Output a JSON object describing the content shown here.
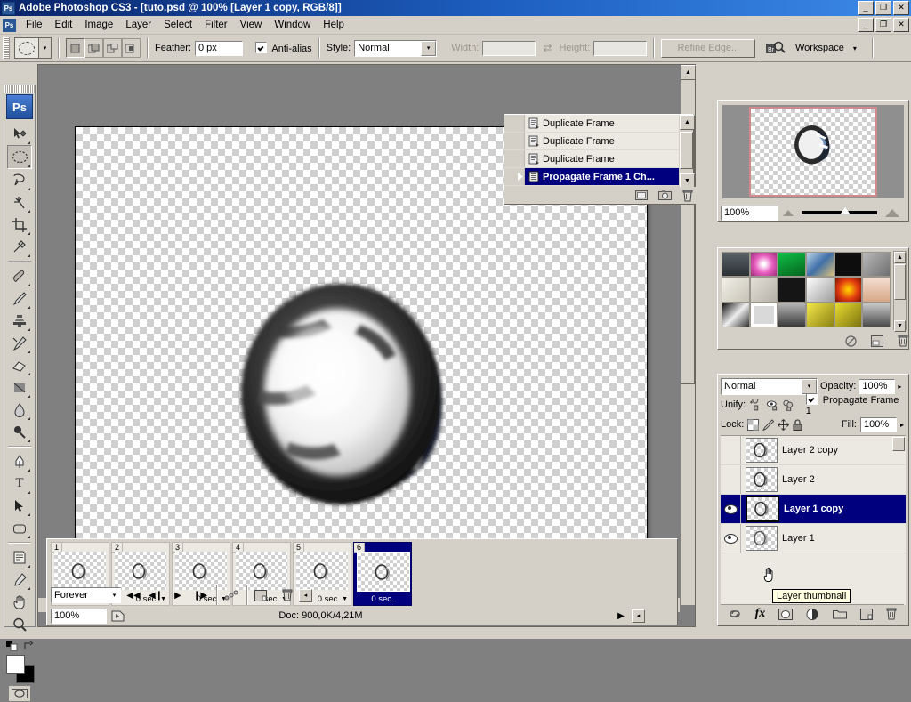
{
  "window": {
    "title": "Adobe Photoshop CS3 - [tuto.psd @ 100% [Layer 1 copy, RGB/8]]",
    "app_icon": "Ps",
    "minimize": "_",
    "restore": "❐",
    "close": "✕"
  },
  "menubar": {
    "app_icon": "Ps",
    "items": [
      {
        "label": "File"
      },
      {
        "label": "Edit"
      },
      {
        "label": "Image"
      },
      {
        "label": "Layer"
      },
      {
        "label": "Select"
      },
      {
        "label": "Filter"
      },
      {
        "label": "View"
      },
      {
        "label": "Window"
      },
      {
        "label": "Help"
      }
    ],
    "minimize": "_",
    "restore": "❐",
    "close": "✕"
  },
  "optionsbar": {
    "tool_icon": "elliptical-marquee",
    "tool_dropdown_arrow": "▾",
    "selection_modes": [
      "new-selection",
      "add-to-selection",
      "subtract-from-selection",
      "intersect-with-selection"
    ],
    "feather_label": "Feather:",
    "feather_value": "0 px",
    "antialias_label": "Anti-alias",
    "antialias_checked": true,
    "style_label": "Style:",
    "style_value": "Normal",
    "style_arrow": "▾",
    "width_label": "Width:",
    "width_value": "",
    "swap_icon": "⇄",
    "height_label": "Height:",
    "height_value": "",
    "refine_edge_label": "Refine Edge...",
    "refine_edge_enabled": false,
    "bridge_icon": "Br",
    "workspace_label": "Workspace",
    "workspace_arrow": "▾"
  },
  "toolbox": {
    "logo": "Ps",
    "tools": [
      {
        "name": "move-tool",
        "glyph": "↖",
        "selected": false,
        "has_flyout": false
      },
      {
        "name": "elliptical-marquee-tool",
        "glyph": "◯",
        "selected": true,
        "has_flyout": true
      },
      {
        "name": "lasso-tool",
        "glyph": "☂",
        "selected": false,
        "has_flyout": true
      },
      {
        "name": "magic-wand-tool",
        "glyph": "✳",
        "selected": false,
        "has_flyout": true
      },
      {
        "name": "crop-tool",
        "glyph": "⌦",
        "selected": false,
        "has_flyout": true
      },
      {
        "name": "slice-tool",
        "glyph": "✂",
        "selected": false,
        "has_flyout": true
      },
      {
        "name": "healing-brush-tool",
        "glyph": "✎",
        "selected": false,
        "has_flyout": true
      },
      {
        "name": "brush-tool",
        "glyph": "✐",
        "selected": false,
        "has_flyout": true
      },
      {
        "name": "clone-stamp-tool",
        "glyph": "⚓",
        "selected": false,
        "has_flyout": true
      },
      {
        "name": "history-brush-tool",
        "glyph": "✒",
        "selected": false,
        "has_flyout": true
      },
      {
        "name": "eraser-tool",
        "glyph": "▱",
        "selected": false,
        "has_flyout": true
      },
      {
        "name": "gradient-tool",
        "glyph": "◢",
        "selected": false,
        "has_flyout": true
      },
      {
        "name": "blur-tool",
        "glyph": "●",
        "selected": false,
        "has_flyout": true
      },
      {
        "name": "dodge-tool",
        "glyph": "⚲",
        "selected": false,
        "has_flyout": true
      },
      {
        "name": "pen-tool",
        "glyph": "✑",
        "selected": false,
        "has_flyout": true
      },
      {
        "name": "horizontal-type-tool",
        "glyph": "T",
        "selected": false,
        "has_flyout": true
      },
      {
        "name": "path-selection-tool",
        "glyph": "➤",
        "selected": false,
        "has_flyout": true
      },
      {
        "name": "rounded-rectangle-tool",
        "glyph": "▭",
        "selected": false,
        "has_flyout": true
      },
      {
        "name": "notes-tool",
        "glyph": "▤",
        "selected": false,
        "has_flyout": true
      },
      {
        "name": "eyedropper-tool",
        "glyph": "⚒",
        "selected": false,
        "has_flyout": true
      },
      {
        "name": "hand-tool",
        "glyph": "✋",
        "selected": false,
        "has_flyout": false
      },
      {
        "name": "zoom-tool",
        "glyph": "⚲",
        "selected": false,
        "has_flyout": false
      }
    ],
    "default_colors_icon": "default-colors",
    "swap_colors_icon": "swap-colors",
    "foreground_color": "#ffffff",
    "background_color": "#000000",
    "quickmask_icon": "quick-mask-mode"
  },
  "history_panel": {
    "rows": [
      {
        "label": "Duplicate Frame",
        "selected": false
      },
      {
        "label": "Duplicate Frame",
        "selected": false
      },
      {
        "label": "Duplicate Frame",
        "selected": false
      },
      {
        "label": "Propagate Frame 1 Ch...",
        "selected": true
      }
    ],
    "scroll_up": "▲",
    "scroll_down": "▼",
    "footer_buttons": [
      "create-document-from-state",
      "create-new-snapshot",
      "delete-state"
    ]
  },
  "navigator": {
    "zoom_value": "100%",
    "zoom_out_icon": "zoom-out",
    "zoom_in_icon": "zoom-in",
    "view_box_color": "#d08a8e"
  },
  "styles_panel": {
    "swatches": [
      "#3b4246",
      "#e85fc0",
      "#0a8c2e",
      "#5f88c4",
      "#111111",
      "#8d8d8d",
      "#ddd9ce",
      "#cfccc4",
      "#1a1a1a",
      "#dcdcdc",
      "#e03a10",
      "#e8c0a8",
      "#4a4a4a",
      "#d8d8d8",
      "#5a5a5a",
      "#d8d02a",
      "#c8c020",
      "#6a6a6a"
    ],
    "footer_buttons": [
      "clear-style",
      "create-new-style",
      "delete-style"
    ]
  },
  "layers_panel": {
    "blend_mode": "Normal",
    "blend_mode_arrow": "▾",
    "opacity_label": "Opacity:",
    "opacity_value": "100%",
    "opacity_arrow": "▸",
    "unify_label": "Unify:",
    "unify_buttons": [
      "unify-layer-position",
      "unify-layer-visibility",
      "unify-layer-style"
    ],
    "propagate_label": "Propagate Frame 1",
    "propagate_checked": true,
    "lock_label": "Lock:",
    "lock_buttons": [
      "lock-transparent-pixels",
      "lock-image-pixels",
      "lock-position",
      "lock-all"
    ],
    "fill_label": "Fill:",
    "fill_value": "100%",
    "fill_arrow": "▸",
    "layers": [
      {
        "name": "Layer 2 copy",
        "visible": false,
        "selected": false,
        "active_thumb": false
      },
      {
        "name": "Layer 2",
        "visible": false,
        "selected": false,
        "active_thumb": false
      },
      {
        "name": "Layer 1 copy",
        "visible": true,
        "selected": true,
        "active_thumb": true
      },
      {
        "name": "Layer 1",
        "visible": true,
        "selected": false,
        "active_thumb": false
      }
    ],
    "tooltip": "Layer thumbnail",
    "footer_buttons": [
      "link-layers",
      "add-layer-style",
      "add-layer-mask",
      "create-adjustment-layer",
      "create-new-group",
      "create-new-layer",
      "delete-layer"
    ],
    "fx_label": "fx"
  },
  "animation_panel": {
    "frames": [
      {
        "number": "1",
        "delay": "0 sec.",
        "selected": false
      },
      {
        "number": "2",
        "delay": "0 sec.",
        "selected": false
      },
      {
        "number": "3",
        "delay": "0 sec.",
        "selected": false
      },
      {
        "number": "4",
        "delay": "0 sec.",
        "selected": false
      },
      {
        "number": "5",
        "delay": "0 sec.",
        "selected": false
      },
      {
        "number": "6",
        "delay": "0 sec.",
        "selected": true
      }
    ],
    "loop_value": "Forever",
    "loop_arrow": "▾",
    "transport": [
      {
        "name": "select-first-frame",
        "glyph": "◀◀"
      },
      {
        "name": "select-previous-frame",
        "glyph": "◀❙"
      },
      {
        "name": "play-animation",
        "glyph": "▶"
      },
      {
        "name": "select-next-frame",
        "glyph": "❙▶"
      }
    ],
    "tween_icon": "tween-animation-frames",
    "duplicate_icon": "duplicate-selected-frames",
    "delete_icon": "delete-selected-frames",
    "convert_timeline_icon": "convert-to-timeline"
  },
  "statusbar": {
    "zoom_value": "100%",
    "preview_icon": "preview-in-browser",
    "doc_info": "Doc: 900,0K/4,21M"
  },
  "colors": {
    "titlebar_start": "#0a246a",
    "titlebar_end": "#3c8ae8",
    "panel_bg": "#d4d0c8",
    "selection_blue": "#00007f",
    "canvas_bg": "#808080",
    "tooltip_bg": "#ffffe1"
  }
}
